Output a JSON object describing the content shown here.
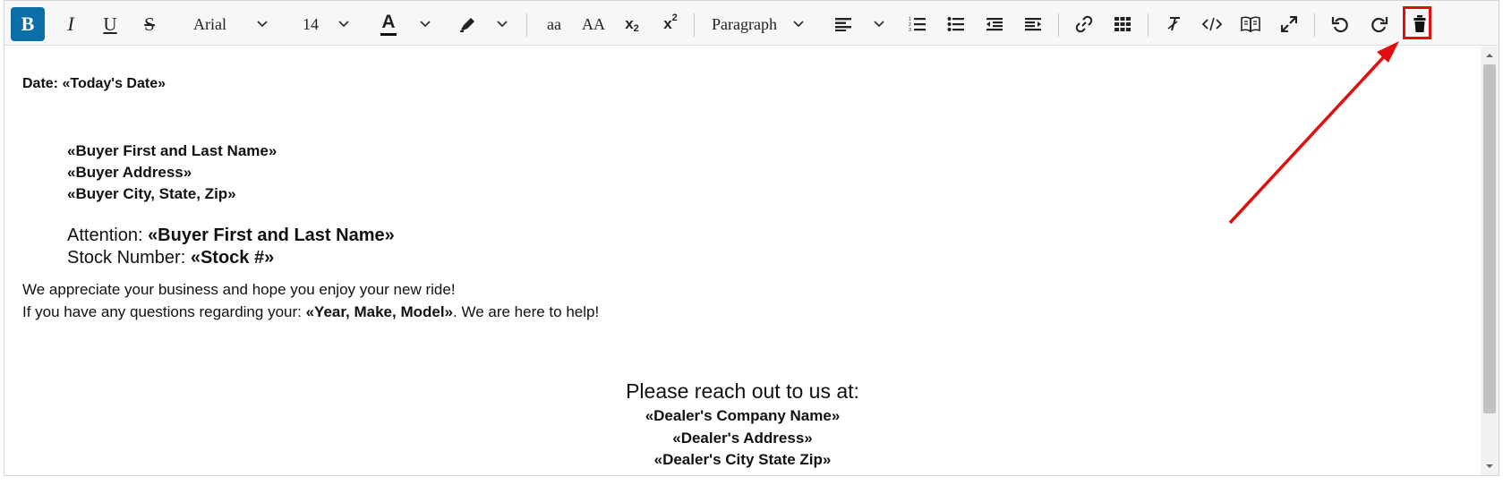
{
  "toolbar": {
    "bold": "B",
    "italic": "I",
    "underline": "U",
    "strike": "S",
    "font_family": "Arial",
    "font_size": "14",
    "text_color_letter": "A",
    "lowercase": "aa",
    "uppercase": "AA",
    "subscript_base": "x",
    "subscript_mark": "2",
    "superscript_base": "x",
    "superscript_mark": "2",
    "block_format": "Paragraph",
    "highlight_color": "#e01010",
    "active_color": "#0b6ea8"
  },
  "document": {
    "date_label": "Date: ",
    "date_field": "«Today's Date»",
    "buyer_name": "«Buyer First and Last Name»",
    "buyer_address": "«Buyer Address»",
    "buyer_city": "«Buyer City, State, Zip»",
    "attention_label": "Attention: ",
    "attention_field": "«Buyer First and Last Name»",
    "stock_label": "Stock Number: ",
    "stock_field": "«Stock #»",
    "appreciate": "We appreciate your business and hope you enjoy your new ride!",
    "questions_pre": "If you have any questions regarding your: ",
    "questions_field": "«Year, Make, Model»",
    "questions_post": ". We are here to help!",
    "reach_out": "Please reach out to us at:",
    "dealer_company": "«Dealer's Company Name»",
    "dealer_address": "«Dealer's Address»",
    "dealer_city": "«Dealer's City State Zip»"
  }
}
